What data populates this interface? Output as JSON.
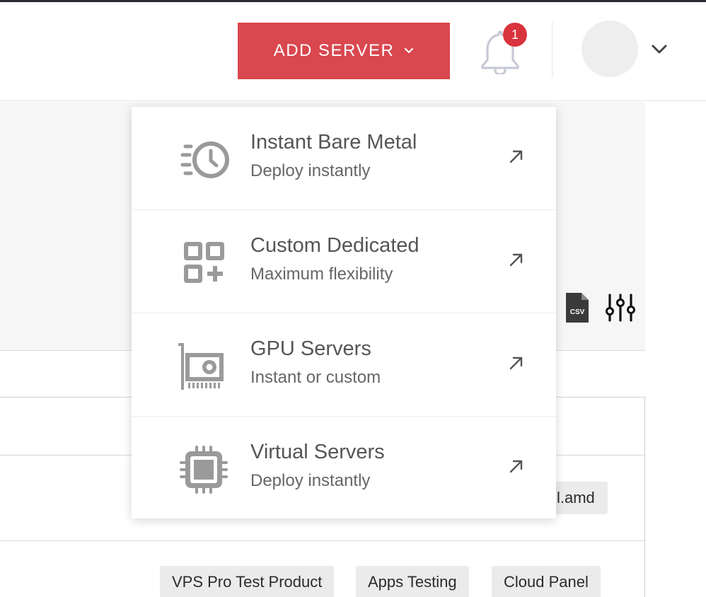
{
  "header": {
    "add_server_label": "ADD SERVER",
    "notification_count": "1"
  },
  "dropdown": {
    "items": [
      {
        "title": "Instant Bare Metal",
        "subtitle": "Deploy instantly",
        "icon": "clock-speed-icon"
      },
      {
        "title": "Custom Dedicated",
        "subtitle": "Maximum flexibility",
        "icon": "grid-plus-icon"
      },
      {
        "title": "GPU Servers",
        "subtitle": "Instant or custom",
        "icon": "gpu-card-icon"
      },
      {
        "title": "Virtual Servers",
        "subtitle": "Deploy instantly",
        "icon": "cpu-chip-icon"
      }
    ]
  },
  "background": {
    "partial_tag": "l.amd",
    "tags": [
      "VPS Pro Test Product",
      "Apps Testing",
      "Cloud Panel"
    ],
    "csv_label": "CSV"
  },
  "colors": {
    "accent": "#d9474f",
    "badge": "#d9333d",
    "icon_grey": "#9a9a9a"
  }
}
